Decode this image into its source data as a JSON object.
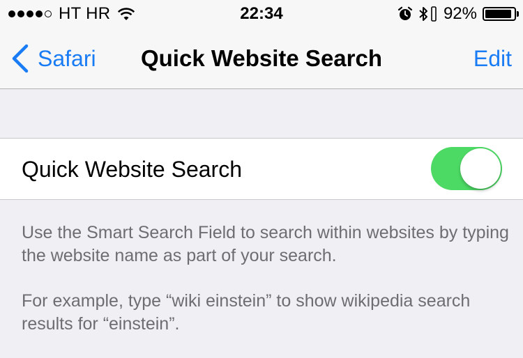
{
  "status_bar": {
    "signal_bars": 4,
    "signal_max": 5,
    "carrier": "HT HR",
    "time": "22:34",
    "battery_percent": "92%",
    "battery_level": 0.92,
    "icons": [
      "wifi-icon",
      "alarm-icon",
      "bluetooth-icon",
      "orientation-lock-icon",
      "battery-icon"
    ]
  },
  "nav": {
    "back_label": "Safari",
    "title": "Quick Website Search",
    "edit_label": "Edit"
  },
  "setting": {
    "label": "Quick Website Search",
    "toggle_on": true,
    "toggle_color": "#4cd964"
  },
  "footer": {
    "paragraph_1": "Use the Smart Search Field to search within websites by typing the website name as part of your search.",
    "paragraph_2": "For example, type “wiki einstein” to show wikipedia search results for “einstein”."
  },
  "colors": {
    "accent": "#1a7cf5",
    "background": "#efeff4",
    "footer_text": "#6d6d72"
  }
}
